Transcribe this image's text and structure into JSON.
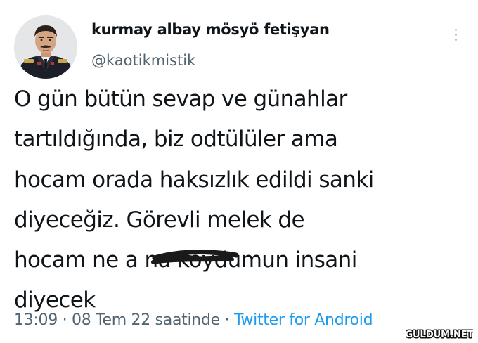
{
  "author": {
    "display_name": "kurmay albay mösyö fetişyan",
    "handle": "@kaotikmistik"
  },
  "tweet": {
    "lines": [
      "O gün bütün sevap ve günahlar",
      "tartıldığında, biz odtülüler ama",
      "hocam orada haksızlık edildi sanki",
      "diyeceğiz. Görevli melek de",
      "hocam ne a    na koydumun insani",
      "diyecek"
    ]
  },
  "meta": {
    "time": "13:09",
    "separator1": " · ",
    "date": "08 Tem 22 saatinde",
    "separator2": " · ",
    "source": "Twitter for Android"
  },
  "icons": {
    "more": "more-vertical-icon",
    "avatar": "military-officer-portrait"
  },
  "watermark": {
    "text": "GULDUM.NET"
  },
  "colors": {
    "text": "#0f1419",
    "secondary": "#536471",
    "link": "#1d9bf0",
    "background": "#ffffff"
  }
}
